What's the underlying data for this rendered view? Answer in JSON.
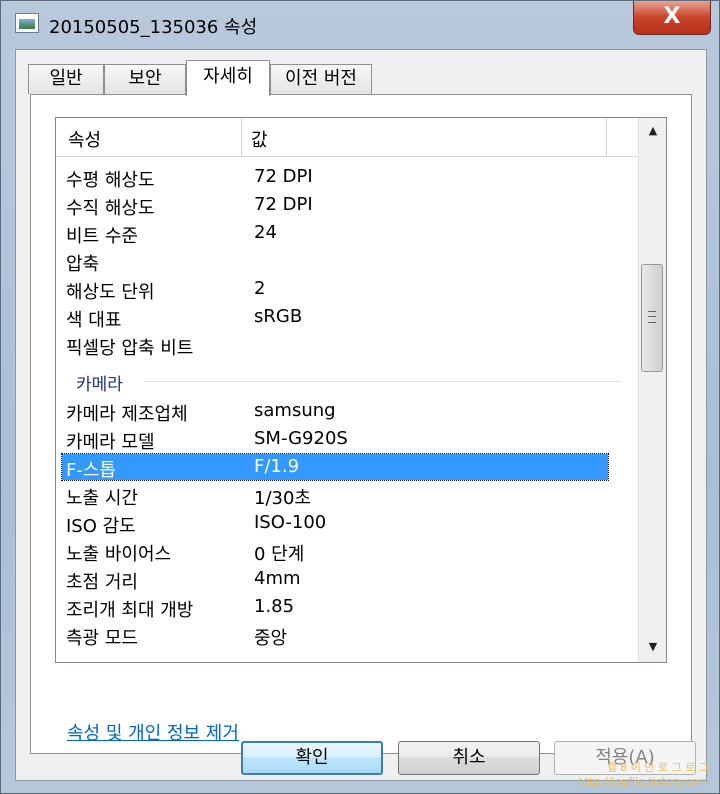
{
  "window": {
    "title": "20150505_135036 속성",
    "close_symbol": "X"
  },
  "tabs": [
    {
      "label": "일반"
    },
    {
      "label": "보안"
    },
    {
      "label": "자세히",
      "active": true
    },
    {
      "label": "이전 버전"
    }
  ],
  "list": {
    "columns": {
      "property": "속성",
      "value": "값"
    },
    "rows": [
      {
        "k": "수평 해상도",
        "v": "72 DPI"
      },
      {
        "k": "수직 해상도",
        "v": "72 DPI"
      },
      {
        "k": "비트 수준",
        "v": "24"
      },
      {
        "k": "압축",
        "v": ""
      },
      {
        "k": "해상도 단위",
        "v": "2"
      },
      {
        "k": "색 대표",
        "v": "sRGB"
      },
      {
        "k": "픽셀당 압축 비트",
        "v": ""
      }
    ],
    "group": "카메라",
    "camera_rows": [
      {
        "k": "카메라 제조업체",
        "v": "samsung"
      },
      {
        "k": "카메라 모델",
        "v": "SM-G920S"
      },
      {
        "k": "F-스톱",
        "v": "F/1.9",
        "selected": true
      },
      {
        "k": "노출 시간",
        "v": "1/30초"
      },
      {
        "k": "ISO 감도",
        "v": "ISO-100"
      },
      {
        "k": "노출 바이어스",
        "v": "0 단계"
      },
      {
        "k": "초점 거리",
        "v": "4mm"
      },
      {
        "k": "조리개 최대 개방",
        "v": "1.85"
      },
      {
        "k": "측광 모드",
        "v": "중앙"
      }
    ],
    "scroll_fraction": 0.35
  },
  "remove_link": "속성 및 개인 정보 제거",
  "buttons": {
    "ok": "확인",
    "cancel": "취소",
    "apply": "적용(A)"
  },
  "watermark": {
    "line1": "갤 8 이 안 로 그 로 그",
    "line2": "http://logfile.tistory.com"
  }
}
